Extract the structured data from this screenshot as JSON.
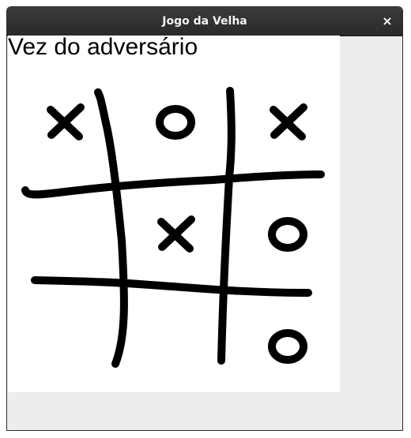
{
  "window": {
    "title": "Jogo da Velha",
    "close_label": "×"
  },
  "game": {
    "status": "Vez do adversário",
    "board": [
      [
        "X",
        "O",
        "X"
      ],
      [
        "",
        "X",
        "O"
      ],
      [
        "",
        "",
        "O"
      ]
    ]
  },
  "colors": {
    "titlebar": "#2e2e2e",
    "title_text": "#f2f2f2",
    "ink": "#000000",
    "canvas": "#ffffff",
    "window_bg": "#ededed"
  }
}
